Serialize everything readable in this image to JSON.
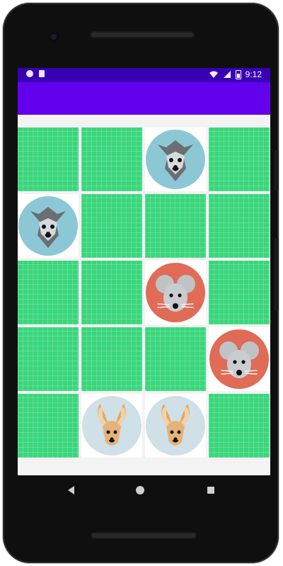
{
  "status_bar": {
    "time": "9:12"
  },
  "board": {
    "tiles": [
      {
        "state": "hidden"
      },
      {
        "state": "hidden"
      },
      {
        "state": "revealed",
        "animal": "wolf"
      },
      {
        "state": "hidden"
      },
      {
        "state": "revealed",
        "animal": "wolf"
      },
      {
        "state": "hidden"
      },
      {
        "state": "hidden"
      },
      {
        "state": "hidden"
      },
      {
        "state": "hidden"
      },
      {
        "state": "hidden"
      },
      {
        "state": "revealed",
        "animal": "mouse"
      },
      {
        "state": "hidden"
      },
      {
        "state": "hidden"
      },
      {
        "state": "hidden"
      },
      {
        "state": "hidden"
      },
      {
        "state": "revealed",
        "animal": "mouse"
      },
      {
        "state": "hidden"
      },
      {
        "state": "revealed",
        "animal": "kangaroo"
      },
      {
        "state": "revealed",
        "animal": "kangaroo"
      },
      {
        "state": "hidden"
      }
    ],
    "colors": {
      "hidden": "#3ad67c",
      "wolf_bg": "#8cc7d6",
      "mouse_bg": "#e06b57",
      "kangaroo_bg": "#cfe0e6"
    }
  },
  "nav": {
    "back": "back-icon",
    "home": "home-icon",
    "recents": "recents-icon"
  }
}
